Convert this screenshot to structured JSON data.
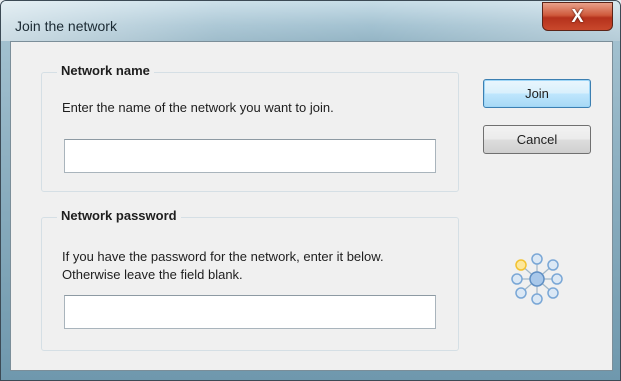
{
  "window": {
    "title": "Join the network",
    "close_label": "X"
  },
  "network_name": {
    "legend": "Network name",
    "instruction": "Enter the name of the network you want to join.",
    "value": "",
    "placeholder": ""
  },
  "network_password": {
    "legend": "Network password",
    "instruction": "If you have the password for the network, enter it below. Otherwise leave the field blank.",
    "value": "",
    "placeholder": ""
  },
  "buttons": {
    "join": "Join",
    "cancel": "Cancel"
  },
  "icons": {
    "network": "network-peers-icon",
    "close": "close-icon"
  },
  "colors": {
    "default_button_border": "#3c7fb1",
    "close_button": "#c9482c",
    "node_blue": "#7aa7d6",
    "node_yellow": "#f2c230"
  }
}
